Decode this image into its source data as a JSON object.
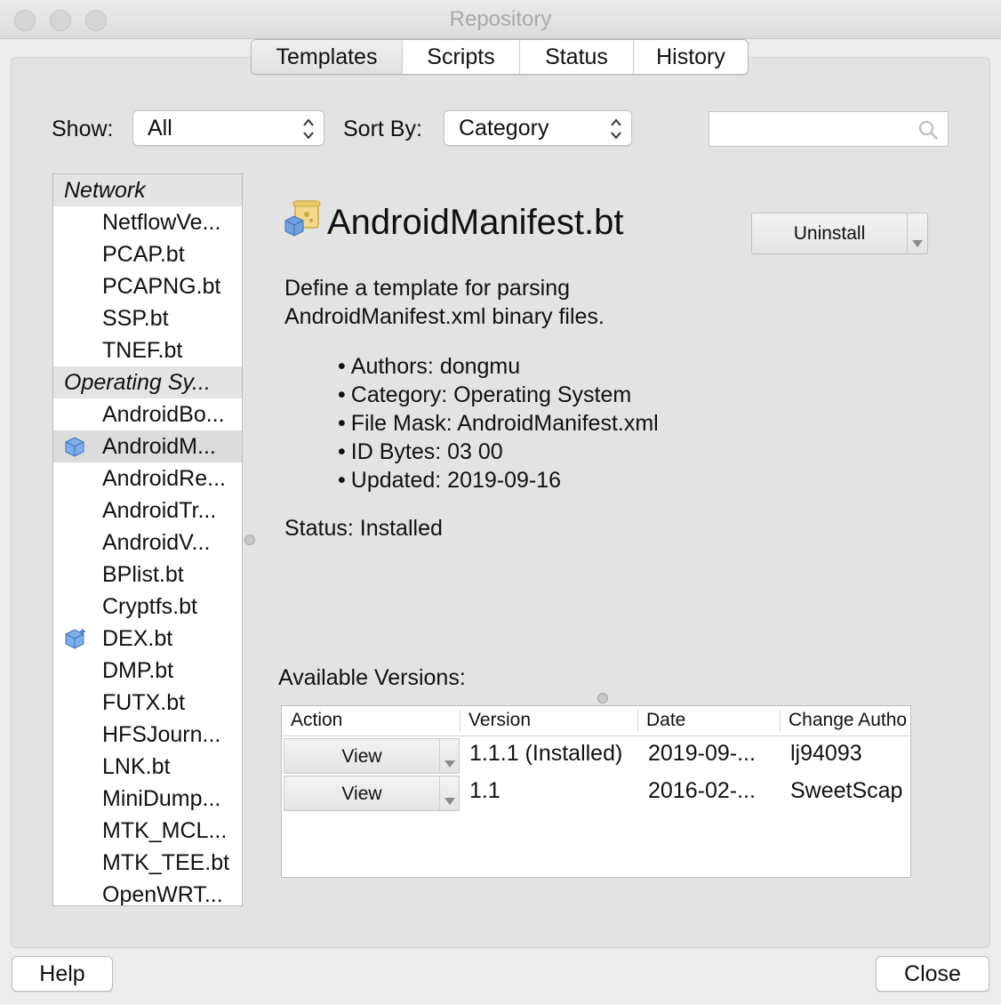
{
  "window": {
    "title": "Repository"
  },
  "tabs": [
    {
      "label": "Templates",
      "active": true
    },
    {
      "label": "Scripts",
      "active": false
    },
    {
      "label": "Status",
      "active": false
    },
    {
      "label": "History",
      "active": false
    }
  ],
  "toolbar": {
    "show_label": "Show:",
    "show_value": "All",
    "sort_label": "Sort By:",
    "sort_value": "Category",
    "search_value": ""
  },
  "list": [
    {
      "type": "category",
      "label": "Network"
    },
    {
      "type": "item",
      "label": "NetflowVe..."
    },
    {
      "type": "item",
      "label": "PCAP.bt"
    },
    {
      "type": "item",
      "label": "PCAPNG.bt"
    },
    {
      "type": "item",
      "label": "SSP.bt"
    },
    {
      "type": "item",
      "label": "TNEF.bt"
    },
    {
      "type": "category",
      "label": "Operating Sy..."
    },
    {
      "type": "item",
      "label": "AndroidBo..."
    },
    {
      "type": "item",
      "label": "AndroidM...",
      "selected": true,
      "icon": "installed-cube-icon"
    },
    {
      "type": "item",
      "label": "AndroidRe..."
    },
    {
      "type": "item",
      "label": "AndroidTr..."
    },
    {
      "type": "item",
      "label": "AndroidV..."
    },
    {
      "type": "item",
      "label": "BPlist.bt"
    },
    {
      "type": "item",
      "label": "Cryptfs.bt"
    },
    {
      "type": "item",
      "label": "DEX.bt",
      "icon": "update-cube-icon"
    },
    {
      "type": "item",
      "label": "DMP.bt"
    },
    {
      "type": "item",
      "label": "FUTX.bt"
    },
    {
      "type": "item",
      "label": "HFSJourn..."
    },
    {
      "type": "item",
      "label": "LNK.bt"
    },
    {
      "type": "item",
      "label": "MiniDump..."
    },
    {
      "type": "item",
      "label": "MTK_MCL..."
    },
    {
      "type": "item",
      "label": "MTK_TEE.bt"
    },
    {
      "type": "item",
      "label": "OpenWRT..."
    }
  ],
  "detail": {
    "title": "AndroidManifest.bt",
    "icon": "template-scroll-icon",
    "uninstall_label": "Uninstall",
    "description": [
      "Define a template for parsing",
      "AndroidManifest.xml binary files."
    ],
    "bullets": [
      "Authors: dongmu",
      "Category: Operating System",
      "File Mask: AndroidManifest.xml",
      "ID Bytes: 03 00",
      "Updated: 2019-09-16"
    ],
    "status": "Status: Installed"
  },
  "versions": {
    "label": "Available Versions:",
    "columns": [
      "Action",
      "Version",
      "Date",
      "Change Autho"
    ],
    "rows": [
      {
        "action": "View",
        "version": "1.1.1 (Installed)",
        "date": "2019-09-...",
        "author": "lj94093"
      },
      {
        "action": "View",
        "version": "1.1",
        "date": "2016-02-...",
        "author": "SweetScap"
      }
    ]
  },
  "footer": {
    "help_label": "Help",
    "close_label": "Close"
  },
  "colors": {
    "window_bg": "#ececec",
    "panel_bg": "#e3e3e3",
    "selection": "#dcdcdc",
    "cube_blue": "#5b8fd6"
  }
}
